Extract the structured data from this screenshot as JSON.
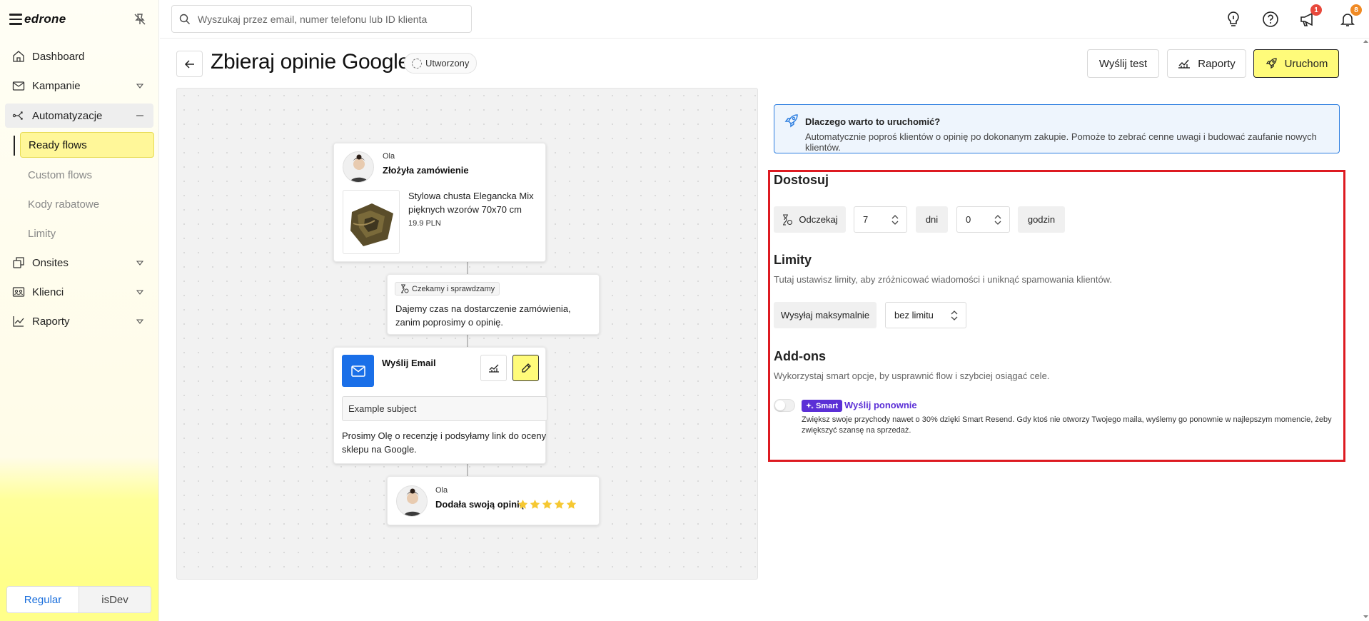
{
  "app": {
    "logo": "edrone"
  },
  "sidebar": {
    "items": [
      {
        "label": "Dashboard"
      },
      {
        "label": "Kampanie"
      },
      {
        "label": "Automatyzacje"
      },
      {
        "label": "Onsites"
      },
      {
        "label": "Klienci"
      },
      {
        "label": "Raporty"
      }
    ],
    "sub_items": [
      {
        "label": "Ready flows"
      },
      {
        "label": "Custom flows"
      },
      {
        "label": "Kody rabatowe"
      },
      {
        "label": "Limity"
      }
    ],
    "mode": {
      "regular": "Regular",
      "dev": "isDev"
    }
  },
  "search": {
    "placeholder": "Wyszukaj przez email, numer telefonu lub ID klienta",
    "value": ""
  },
  "topbar": {
    "megaphone_badge": "1",
    "bell_badge": "8"
  },
  "header": {
    "title": "Zbieraj opinie Google",
    "status": "Utworzony",
    "send_test": "Wyślij test",
    "reports": "Raporty",
    "launch": "Uruchom"
  },
  "flow": {
    "order_card": {
      "name": "Ola",
      "action": "Złożyła zamówienie",
      "product": "Stylowa chusta Elegancka Mix pięknych wzorów 70x70 cm",
      "price": "19.9 PLN"
    },
    "wait_card": {
      "chip": "Czekamy i sprawdzamy",
      "text": "Dajemy czas na dostarczenie zamówienia, zanim poprosimy o opinię."
    },
    "email_card": {
      "title": "Wyślij Email",
      "subject": "Example subject",
      "text": "Prosimy Olę o recenzję i podsyłamy link do oceny sklepu na Google."
    },
    "review_card": {
      "name": "Ola",
      "action": "Dodała swoją opinię",
      "stars": 5
    }
  },
  "info": {
    "title": "Dlaczego warto to uruchomić?",
    "text": "Automatycznie poproś klientów o opinię po dokonanym zakupie. Pomoże to zebrać cenne uwagi i budować zaufanie nowych klientów."
  },
  "customize": {
    "title": "Dostosuj",
    "wait_label": "Odczekaj",
    "days_value": "7",
    "days_label": "dni",
    "hours_value": "0",
    "hours_label": "godzin"
  },
  "limits": {
    "title": "Limity",
    "desc": "Tutaj ustawisz limity, aby zróżnicować wiadomości i uniknąć spamowania klientów.",
    "send_max_label": "Wysyłaj maksymalnie",
    "limit_value": "bez limitu"
  },
  "addons": {
    "title": "Add-ons",
    "desc": "Wykorzystaj smart opcje, by usprawnić flow i szybciej osiągać cele.",
    "smart_chip": "Smart",
    "resend_label": "Wyślij ponownie",
    "resend_desc": "Zwiększ swoje przychody nawet o 30% dzięki Smart Resend. Gdy ktoś nie otworzy Twojego maila, wyślemy go ponownie w najlepszym momencie, żeby zwiększyć szansę na sprzedaż.",
    "resend_enabled": false
  },
  "colors": {
    "accent_yellow": "#fffb7a",
    "primary_blue": "#1a6fe8",
    "smart_purple": "#5b2fd6",
    "highlight_red": "#dd1a21"
  }
}
